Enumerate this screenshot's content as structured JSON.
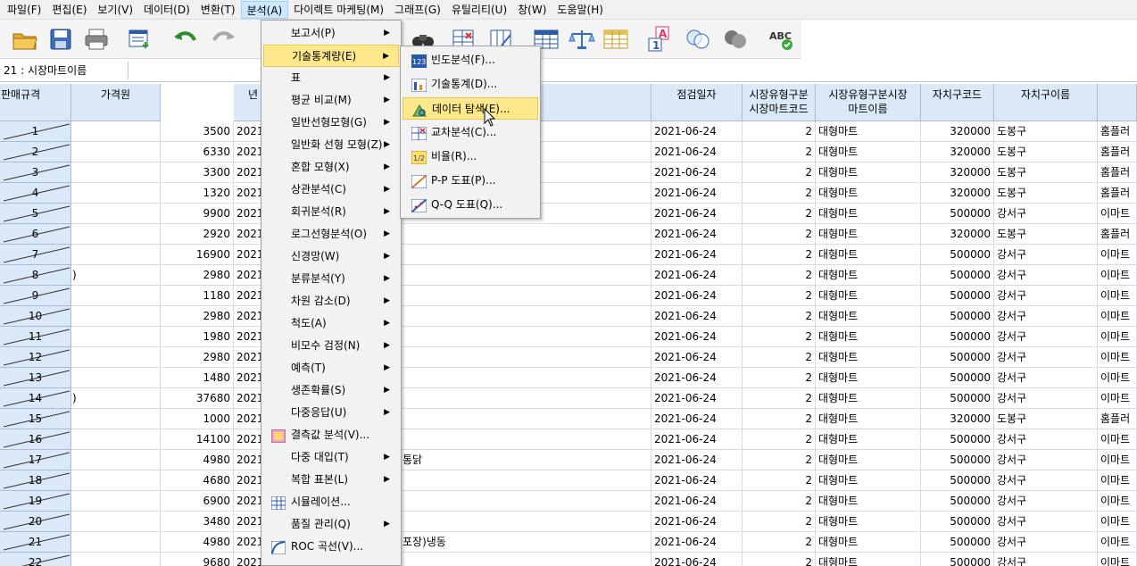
{
  "menubar": [
    "파일(F)",
    "편집(E)",
    "보기(V)",
    "데이터(D)",
    "변환(T)",
    "분석(A)",
    "다이렉트 마케팅(M)",
    "그래프(G)",
    "유틸리티(U)",
    "창(W)",
    "도움말(H)"
  ],
  "cellbar": {
    "ref": "21 : 시장마트이름",
    "value": ""
  },
  "columns": {
    "c0": "판매규격",
    "c1": "가격원",
    "c2": "년",
    "c3": "점검일자",
    "c4a": "시장유형구분",
    "c4b": "시장마트코드",
    "c5a": "시장유형구분시장",
    "c5b": "마트이름",
    "c6": "자치구코드",
    "c7": "자치구이름"
  },
  "rows": [
    {
      "n": "1",
      "spec": "",
      "price": "3500",
      "year": "2021",
      "item": "",
      "date": "2021-06-24",
      "type": "2",
      "mart": "대형마트",
      "code": "320000",
      "gu": "도봉구",
      "name": "홈플러"
    },
    {
      "n": "2",
      "spec": "",
      "price": "6330",
      "year": "2021",
      "item": "",
      "date": "2021-06-24",
      "type": "2",
      "mart": "대형마트",
      "code": "320000",
      "gu": "도봉구",
      "name": "홈플러"
    },
    {
      "n": "3",
      "spec": "",
      "price": "3300",
      "year": "2021",
      "item": "",
      "date": "2021-06-24",
      "type": "2",
      "mart": "대형마트",
      "code": "320000",
      "gu": "도봉구",
      "name": "홈플러"
    },
    {
      "n": "4",
      "spec": "",
      "price": "1320",
      "year": "2021",
      "item": "",
      "date": "2021-06-24",
      "type": "2",
      "mart": "대형마트",
      "code": "320000",
      "gu": "도봉구",
      "name": "홈플러"
    },
    {
      "n": "5",
      "spec": "",
      "price": "9900",
      "year": "2021",
      "item": "",
      "date": "2021-06-24",
      "type": "2",
      "mart": "대형마트",
      "code": "500000",
      "gu": "강서구",
      "name": "이마트"
    },
    {
      "n": "6",
      "spec": "",
      "price": "2920",
      "year": "2021",
      "item": "",
      "date": "2021-06-24",
      "type": "2",
      "mart": "대형마트",
      "code": "320000",
      "gu": "도봉구",
      "name": "홈플러"
    },
    {
      "n": "7",
      "spec": "",
      "price": "16900",
      "year": "2021",
      "item": "",
      "date": "2021-06-24",
      "type": "2",
      "mart": "대형마트",
      "code": "500000",
      "gu": "강서구",
      "name": "이마트"
    },
    {
      "n": "8",
      "spec": ")",
      "price": "2980",
      "year": "2021",
      "item": "",
      "date": "2021-06-24",
      "type": "2",
      "mart": "대형마트",
      "code": "500000",
      "gu": "강서구",
      "name": "이마트"
    },
    {
      "n": "9",
      "spec": "",
      "price": "1180",
      "year": "2021",
      "item": "",
      "date": "2021-06-24",
      "type": "2",
      "mart": "대형마트",
      "code": "500000",
      "gu": "강서구",
      "name": "이마트"
    },
    {
      "n": "10",
      "spec": "",
      "price": "2980",
      "year": "2021",
      "item": "",
      "date": "2021-06-24",
      "type": "2",
      "mart": "대형마트",
      "code": "500000",
      "gu": "강서구",
      "name": "이마트"
    },
    {
      "n": "11",
      "spec": "",
      "price": "1980",
      "year": "2021",
      "item": "",
      "date": "2021-06-24",
      "type": "2",
      "mart": "대형마트",
      "code": "500000",
      "gu": "강서구",
      "name": "이마트"
    },
    {
      "n": "12",
      "spec": "",
      "price": "2980",
      "year": "2021",
      "item": "",
      "date": "2021-06-24",
      "type": "2",
      "mart": "대형마트",
      "code": "500000",
      "gu": "강서구",
      "name": "이마트"
    },
    {
      "n": "13",
      "spec": "",
      "price": "1480",
      "year": "2021",
      "item": "",
      "date": "2021-06-24",
      "type": "2",
      "mart": "대형마트",
      "code": "500000",
      "gu": "강서구",
      "name": "이마트"
    },
    {
      "n": "14",
      "spec": ")",
      "price": "37680",
      "year": "2021",
      "item": "",
      "date": "2021-06-24",
      "type": "2",
      "mart": "대형마트",
      "code": "500000",
      "gu": "강서구",
      "name": "이마트"
    },
    {
      "n": "15",
      "spec": "",
      "price": "1000",
      "year": "2021",
      "item": "",
      "date": "2021-06-24",
      "type": "2",
      "mart": "대형마트",
      "code": "320000",
      "gu": "도봉구",
      "name": "홈플러"
    },
    {
      "n": "16",
      "spec": "",
      "price": "14100",
      "year": "2021",
      "item": "",
      "date": "2021-06-24",
      "type": "2",
      "mart": "대형마트",
      "code": "500000",
      "gu": "강서구",
      "name": "이마트"
    },
    {
      "n": "17",
      "spec": "",
      "price": "4980",
      "year": "2021",
      "item": "통닭",
      "date": "2021-06-24",
      "type": "2",
      "mart": "대형마트",
      "code": "500000",
      "gu": "강서구",
      "name": "이마트"
    },
    {
      "n": "18",
      "spec": "",
      "price": "4680",
      "year": "2021",
      "item": "",
      "date": "2021-06-24",
      "type": "2",
      "mart": "대형마트",
      "code": "500000",
      "gu": "강서구",
      "name": "이마트"
    },
    {
      "n": "19",
      "spec": "",
      "price": "6900",
      "year": "2021",
      "item": "",
      "date": "2021-06-24",
      "type": "2",
      "mart": "대형마트",
      "code": "500000",
      "gu": "강서구",
      "name": "이마트"
    },
    {
      "n": "20",
      "spec": "",
      "price": "3480",
      "year": "2021",
      "item": "",
      "date": "2021-06-24",
      "type": "2",
      "mart": "대형마트",
      "code": "500000",
      "gu": "강서구",
      "name": "이마트"
    },
    {
      "n": "21",
      "spec": "",
      "price": "4980",
      "year": "2021",
      "item": "포장)냉동",
      "date": "2021-06-24",
      "type": "2",
      "mart": "대형마트",
      "code": "500000",
      "gu": "강서구",
      "name": "이마트"
    },
    {
      "n": "22",
      "spec": "",
      "price": "9680",
      "year": "2021",
      "item": "",
      "date": "2021-06-24",
      "type": "2",
      "mart": "대형마트",
      "code": "500000",
      "gu": "강서구",
      "name": "이마트"
    }
  ],
  "analyze_menu": [
    {
      "label": "보고서(P)",
      "sub": true,
      "icon": ""
    },
    {
      "label": "기술통계량(E)",
      "sub": true,
      "icon": "",
      "highlight": true
    },
    {
      "label": "표",
      "sub": true,
      "icon": ""
    },
    {
      "label": "평균 비교(M)",
      "sub": true,
      "icon": ""
    },
    {
      "label": "일반선형모형(G)",
      "sub": true,
      "icon": ""
    },
    {
      "label": "일반화 선형 모형(Z)",
      "sub": true,
      "icon": ""
    },
    {
      "label": "혼합 모형(X)",
      "sub": true,
      "icon": ""
    },
    {
      "label": "상관분석(C)",
      "sub": true,
      "icon": ""
    },
    {
      "label": "회귀분석(R)",
      "sub": true,
      "icon": ""
    },
    {
      "label": "로그선형분석(O)",
      "sub": true,
      "icon": ""
    },
    {
      "label": "신경망(W)",
      "sub": true,
      "icon": ""
    },
    {
      "label": "분류분석(Y)",
      "sub": true,
      "icon": ""
    },
    {
      "label": "차원 감소(D)",
      "sub": true,
      "icon": ""
    },
    {
      "label": "척도(A)",
      "sub": true,
      "icon": ""
    },
    {
      "label": "비모수 검정(N)",
      "sub": true,
      "icon": ""
    },
    {
      "label": "예측(T)",
      "sub": true,
      "icon": ""
    },
    {
      "label": "생존확률(S)",
      "sub": true,
      "icon": ""
    },
    {
      "label": "다중응답(U)",
      "sub": true,
      "icon": ""
    },
    {
      "label": "결측값 분석(V)...",
      "sub": false,
      "icon": "missing-value-icon"
    },
    {
      "label": "다중 대입(T)",
      "sub": true,
      "icon": ""
    },
    {
      "label": "복합 표본(L)",
      "sub": true,
      "icon": ""
    },
    {
      "label": "시뮬레이션...",
      "sub": false,
      "icon": "simulation-icon"
    },
    {
      "label": "품질 관리(Q)",
      "sub": true,
      "icon": ""
    },
    {
      "label": "ROC 곡선(V)...",
      "sub": false,
      "icon": "roc-curve-icon"
    }
  ],
  "desc_menu": [
    {
      "label": "빈도분석(F)...",
      "icon": "frequencies-icon"
    },
    {
      "label": "기술통계(D)...",
      "icon": "descriptives-icon"
    },
    {
      "label": "데이터 탐색(E)...",
      "icon": "explore-icon",
      "highlight": true
    },
    {
      "label": "교차분석(C)...",
      "icon": "crosstabs-icon"
    },
    {
      "label": "비율(R)...",
      "icon": "ratio-icon"
    },
    {
      "label": "P-P 도표(P)...",
      "icon": "pp-plot-icon"
    },
    {
      "label": "Q-Q 도표(Q)...",
      "icon": "qq-plot-icon"
    }
  ],
  "desc_icon_text": {
    "frequencies": "123",
    "ratio": "1/2"
  },
  "toolbar_icons": [
    "open-folder-icon",
    "save-icon",
    "print-icon",
    "dialog-recall-icon",
    "undo-icon",
    "redo-icon",
    "goto-case-icon",
    "find-icon",
    "insert-cases-icon",
    "insert-variable-icon",
    "split-file-icon",
    "weight-cases-icon",
    "select-cases-icon",
    "value-labels-icon",
    "use-sets-icon",
    "show-all-variables-icon",
    "spell-check-icon"
  ],
  "toolbar_text": {
    "spell": "ABC",
    "value_label": "A"
  }
}
